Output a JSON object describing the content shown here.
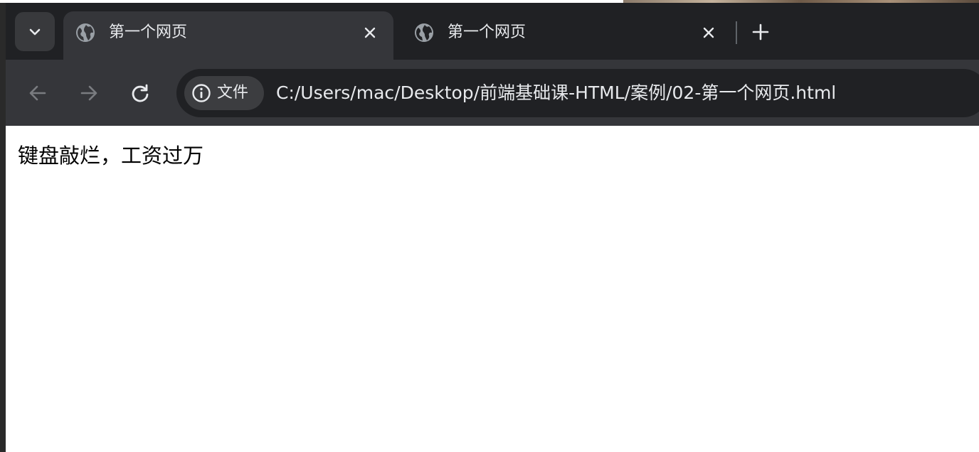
{
  "browser": {
    "tabs": [
      {
        "title": "第一个网页",
        "active": true,
        "favicon": "globe-icon"
      },
      {
        "title": "第一个网页",
        "active": false,
        "favicon": "globe-icon"
      }
    ],
    "tab_search_icon": "chevron-down-icon",
    "new_tab_icon": "plus-icon",
    "close_icon": "close-icon"
  },
  "toolbar": {
    "back_icon": "arrow-left-icon",
    "forward_icon": "arrow-right-icon",
    "reload_icon": "reload-icon",
    "security_chip": {
      "icon": "info-icon",
      "label": "文件"
    },
    "url": "C:/Users/mac/Desktop/前端基础课-HTML/案例/02-第一个网页.html"
  },
  "page": {
    "body_text": "键盘敲烂，工资过万"
  },
  "colors": {
    "chrome_dark": "#202124",
    "toolbar": "#35363a",
    "tab_active": "#35363a",
    "text_light": "#e8eaed",
    "icon_disabled": "#7a7c80",
    "page_bg": "#ffffff",
    "page_text": "#000000"
  }
}
